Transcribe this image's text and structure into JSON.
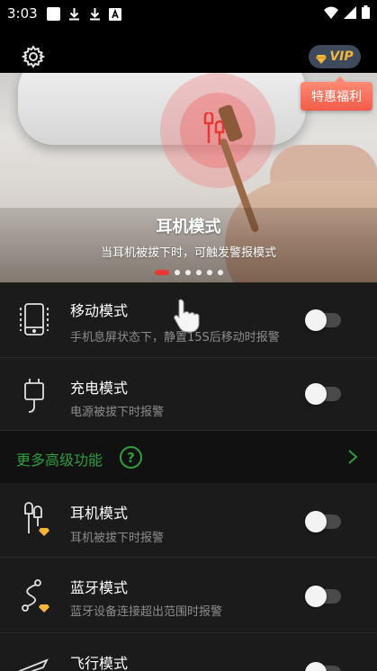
{
  "status_bar": {
    "time": "3:03"
  },
  "header": {
    "vip_label": "VIP"
  },
  "banner": {
    "title": "耳机模式",
    "subtitle": "当耳机被拔下时，可触发警报模式",
    "page_count": 6,
    "active_page": 0
  },
  "promo": {
    "label": "特惠福利"
  },
  "modes": [
    {
      "title": "移动模式",
      "desc": "手机息屏状态下，静置15S后移动时报警",
      "enabled": false
    },
    {
      "title": "充电模式",
      "desc": "电源被拔下时报警",
      "enabled": false
    }
  ],
  "more_features": {
    "label": "更多高级功能",
    "help": "?"
  },
  "premium_modes": [
    {
      "title": "耳机模式",
      "desc": "耳机被拔下时报警",
      "enabled": false
    },
    {
      "title": "蓝牙模式",
      "desc": "蓝牙设备连接超出范围时报警",
      "enabled": false
    },
    {
      "title": "飞行模式",
      "desc": "",
      "enabled": false
    }
  ],
  "colors": {
    "accent_green": "#2e9e3f",
    "vip_gold": "#f5b63a",
    "promo_red": "#f25c4a",
    "dot_active": "#e53935"
  }
}
